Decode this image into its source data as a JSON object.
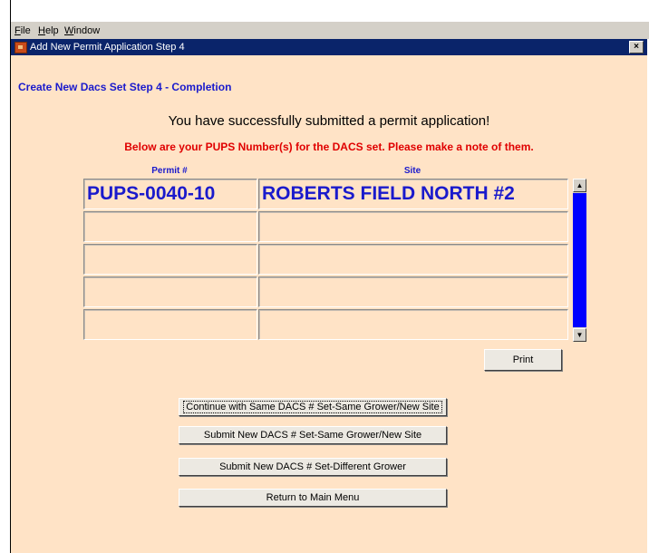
{
  "menubar": {
    "items": [
      {
        "label": "File",
        "mnemonic": "F",
        "rest": "ile"
      },
      {
        "label": "Help",
        "mnemonic": "H",
        "rest": "elp"
      },
      {
        "label": "Window",
        "mnemonic": "W",
        "rest": "indow"
      }
    ]
  },
  "window": {
    "title": "Add New Permit Application Step 4",
    "close_label": "×"
  },
  "content": {
    "step_title": "Create New Dacs Set Step 4 - Completion",
    "success_message": "You have successfully submitted a permit application!",
    "note": "Below are your PUPS Number(s) for the DACS set. Please make a note of them.",
    "columns": [
      "Permit #",
      "Site"
    ],
    "rows": [
      [
        "PUPS-0040-10",
        "ROBERTS FIELD NORTH #2"
      ],
      [
        "",
        ""
      ],
      [
        "",
        ""
      ],
      [
        "",
        ""
      ],
      [
        "",
        ""
      ]
    ],
    "scroll_up": "▲",
    "scroll_down": "▼",
    "print_label": "Print",
    "actions": [
      "Continue with Same DACS # Set-Same Grower/New Site",
      "Submit New DACS # Set-Same Grower/New Site",
      "Submit New DACS # Set-Different Grower",
      "Return to Main Menu"
    ]
  },
  "colors": {
    "background": "#ffe3c6",
    "title_bar": "#0a246a",
    "heading_blue": "#1a1acc",
    "note_red": "#e00000",
    "scroll_thumb": "#0000ff"
  }
}
